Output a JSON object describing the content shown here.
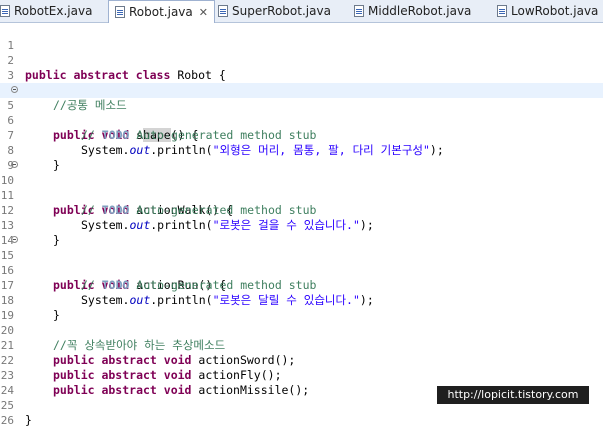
{
  "tabs": [
    {
      "label": "RobotEx.java",
      "active": false
    },
    {
      "label": "Robot.java",
      "active": true,
      "close": "✕"
    },
    {
      "label": "SuperRobot.java",
      "active": false
    },
    {
      "label": "MiddleRobot.java",
      "active": false
    },
    {
      "label": "LowRobot.java",
      "active": false
    }
  ],
  "code": {
    "l2_kw": "public abstract class",
    "l2_name": " Robot {",
    "l4_cm": "//공통 메소드",
    "l5_kw": "public void",
    "l5_a": " s",
    "l5_b": "hape",
    "l5_c": "() {",
    "todo_slash": "// ",
    "todo_tag": "TODO",
    "todo_rest": " Auto-generated method stub",
    "sys": "System.",
    "out": "out",
    "println": ".println(",
    "end": ");",
    "l7_str": "\"외형은 머리, 몸통, 팔, 다리 기본구성\"",
    "brace_close": "}",
    "l10_kw": "public void",
    "l10_rest": " actionWalk() {",
    "l12_str": "\"로봇은 걸을 수 있습니다.\"",
    "l15_kw": "public void",
    "l15_rest": " actionRun() {",
    "l17_str": "\"로봇은 달릴 수 있습니다.\"",
    "l21_cm": "//꼭 상속받아야 하는 추상메소드",
    "abs_kw": "public abstract void",
    "l22_rest": " actionSword();",
    "l23_rest": " actionFly();",
    "l24_rest": " actionMissile();",
    "l26": "}"
  },
  "line_numbers": [
    "1",
    "2",
    "3",
    "4",
    "5",
    "6",
    "7",
    "8",
    "9",
    "10",
    "11",
    "12",
    "13",
    "14",
    "15",
    "16",
    "17",
    "18",
    "19",
    "20",
    "21",
    "22",
    "23",
    "24",
    "25",
    "26"
  ],
  "watermark": "http://lopicit.tistory.com"
}
